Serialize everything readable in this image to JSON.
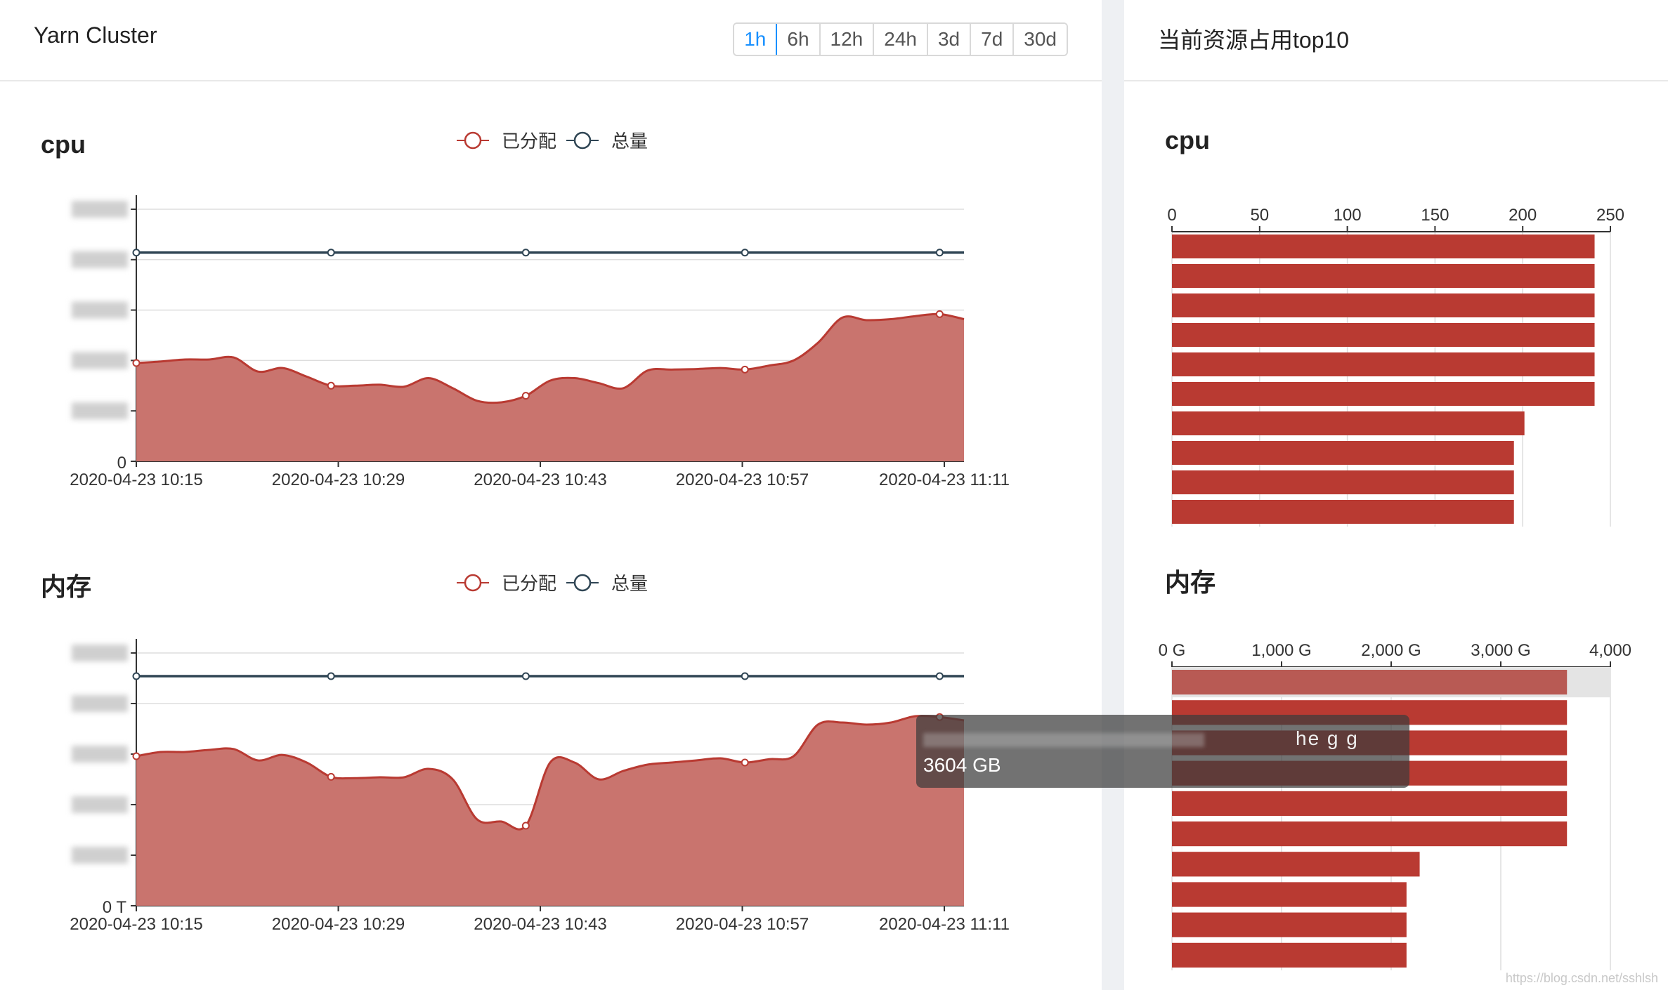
{
  "header": {
    "title": "Yarn Cluster"
  },
  "ranges": [
    "1h",
    "6h",
    "12h",
    "24h",
    "3d",
    "7d",
    "30d"
  ],
  "active_range": "1h",
  "right_header": {
    "title": "当前资源占用top10"
  },
  "tooltip": {
    "name": "he g g",
    "value": "3604 GB"
  },
  "watermark": "https://blog.csdn.net/sshlsh",
  "colors": {
    "allocated": "#b93a32",
    "allocated_fill": "#c9746e",
    "total": "#2f4554",
    "highlight_bg": "#e4e4e4"
  },
  "chart_data": [
    {
      "type": "area",
      "title": "cpu",
      "legend": [
        "已分配",
        "总量"
      ],
      "x_ticks": [
        "2020-04-23 10:15",
        "2020-04-23 10:29",
        "2020-04-23 10:43",
        "2020-04-23 10:57",
        "2020-04-23 11:11"
      ],
      "y_ticks": [
        "0",
        "5"
      ],
      "ylim": [
        0,
        5
      ],
      "series": [
        {
          "name": "已分配",
          "values": [
            1.95,
            1.98,
            2.02,
            2.02,
            2.06,
            1.78,
            1.85,
            1.68,
            1.5,
            1.5,
            1.52,
            1.48,
            1.65,
            1.45,
            1.2,
            1.17,
            1.3,
            1.6,
            1.65,
            1.55,
            1.45,
            1.8,
            1.82,
            1.83,
            1.85,
            1.82,
            1.9,
            2.0,
            2.35,
            2.85,
            2.8,
            2.82,
            2.88,
            2.92,
            2.82
          ]
        },
        {
          "name": "总量",
          "values": [
            4.14,
            4.14,
            4.14,
            4.14,
            4.14,
            4.14,
            4.14,
            4.14,
            4.14,
            4.14,
            4.14,
            4.14,
            4.14,
            4.14,
            4.14,
            4.14,
            4.14,
            4.14,
            4.14,
            4.14,
            4.14,
            4.14,
            4.14,
            4.14,
            4.14,
            4.14,
            4.14,
            4.14,
            4.14,
            4.14,
            4.14,
            4.14,
            4.14,
            4.14,
            4.14
          ]
        }
      ]
    },
    {
      "type": "area",
      "title": "内存",
      "legend": [
        "已分配",
        "总量"
      ],
      "x_ticks": [
        "2020-04-23 10:15",
        "2020-04-23 10:29",
        "2020-04-23 10:43",
        "2020-04-23 10:57",
        "2020-04-23 11:11"
      ],
      "y_ticks": [
        "0 T",
        "T"
      ],
      "ylim": [
        0,
        6
      ],
      "series": [
        {
          "name": "已分配",
          "values": [
            3.55,
            3.65,
            3.65,
            3.7,
            3.72,
            3.45,
            3.58,
            3.4,
            3.06,
            3.03,
            3.05,
            3.05,
            3.25,
            3.0,
            2.05,
            2.0,
            1.9,
            3.4,
            3.4,
            3.0,
            3.2,
            3.35,
            3.4,
            3.45,
            3.5,
            3.4,
            3.48,
            3.55,
            4.3,
            4.35,
            4.3,
            4.35,
            4.5,
            4.48,
            4.4
          ]
        },
        {
          "name": "总量",
          "values": [
            5.45,
            5.45,
            5.45,
            5.45,
            5.45,
            5.45,
            5.45,
            5.45,
            5.45,
            5.45,
            5.45,
            5.45,
            5.45,
            5.45,
            5.45,
            5.45,
            5.45,
            5.45,
            5.45,
            5.45,
            5.45,
            5.45,
            5.45,
            5.45,
            5.45,
            5.45,
            5.45,
            5.45,
            5.45,
            5.45,
            5.45,
            5.45,
            5.45,
            5.45,
            5.45
          ]
        }
      ]
    },
    {
      "type": "bar",
      "orientation": "horizontal",
      "title": "cpu",
      "x_ticks": [
        "0",
        "50",
        "100",
        "150",
        "200",
        "250"
      ],
      "xlim": [
        0,
        250
      ],
      "values": [
        241,
        241,
        241,
        241,
        241,
        241,
        201,
        195,
        195,
        195
      ]
    },
    {
      "type": "bar",
      "orientation": "horizontal",
      "title": "内存",
      "x_ticks": [
        "0 G",
        "1,000 G",
        "2,000 G",
        "3,000 G",
        "4,000"
      ],
      "xlim": [
        0,
        4000
      ],
      "values": [
        3604,
        3604,
        3604,
        3604,
        3604,
        3604,
        2260,
        2140,
        2140,
        2140
      ],
      "highlight_index": 0
    }
  ]
}
